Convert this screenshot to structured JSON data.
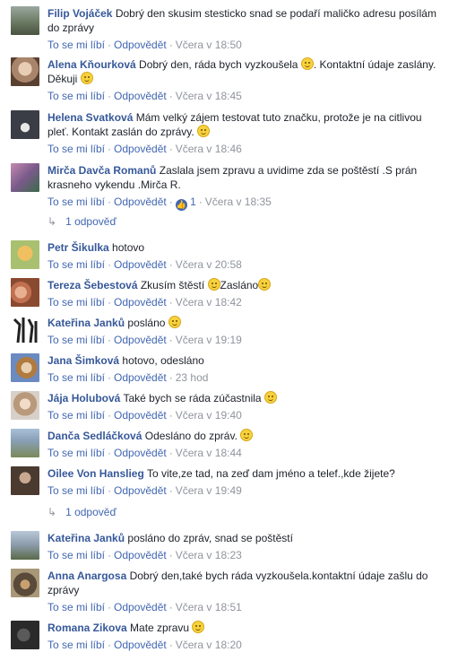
{
  "labels": {
    "like": "To se mi líbí",
    "reply": "Odpovědět",
    "sep": "·"
  },
  "comments": [
    {
      "name": "Filip Vojáček",
      "text": "Dobrý den skusim stesticko snad se podaří maličko adresu posílám do zprávy",
      "time": "Včera v 18:50",
      "avatar_color": "#6b7a62"
    },
    {
      "name": "Alena Kňourková",
      "text": "Dobrý den, ráda bych vyzkoušela",
      "text2": ". Kontaktní údaje zaslány. Děkuji",
      "time": "Včera v 18:45",
      "avatar_color": "#a8846a"
    },
    {
      "name": "Helena Svatková",
      "text": "Mám velký zájem testovat tuto značku, protože je na citlivou pleť. Kontakt zaslán do zprávy.",
      "time": "Včera v 18:46",
      "avatar_color": "#3a3d45"
    },
    {
      "name": "Mirča Davča Romanů",
      "text": "Zaslala jsem zpravu a uvidime zda se poštěstí .S prán krasneho vykendu .Mirča R.",
      "time": "Včera v 18:35",
      "like_count": "1",
      "avatar_color": "#7a5a8a"
    },
    {
      "name": "Petr Šikulka",
      "text": "hotovo",
      "time": "Včera v 20:58",
      "avatar_color": "#d6a84a"
    },
    {
      "name": "Tereza Šebestová",
      "text": "Zkusím štěstí",
      "text2": "Zasláno",
      "time": "Včera v 18:42",
      "avatar_color": "#c07050"
    },
    {
      "name": "Kateřina Janků",
      "text": "posláno",
      "time": "Včera v 19:19",
      "avatar_color": "#222222"
    },
    {
      "name": "Jana Šimková",
      "text": "hotovo, odesláno",
      "time": "23 hod",
      "avatar_color": "#b07a40"
    },
    {
      "name": "Jája Holubová",
      "text": "Také bych se ráda zúčastnila",
      "time": "Včera v 19:40",
      "avatar_color": "#b89a7a"
    },
    {
      "name": "Danča Sedláčková",
      "text": "Odesláno do zpráv.",
      "time": "Včera v 18:44",
      "avatar_color": "#8aa0b8"
    },
    {
      "name": "Oilee Von Hanslieg",
      "text": "To vite,ze tad, na zeď dam jméno a telef.,kde žijete?",
      "time": "Včera v 19:49",
      "avatar_color": "#4a3a30"
    },
    {
      "name": "Kateřina Janků",
      "text": "posláno do zpráv, snad se poštěstí",
      "time": "Včera v 18:23",
      "avatar_color": "#8a9aa8"
    },
    {
      "name": "Anna Anargosa",
      "text": "Dobrý den,také bych ráda vyzkoušela.kontaktní údaje zašlu do zprávy",
      "time": "Včera v 18:51",
      "avatar_color": "#5a4a3a"
    },
    {
      "name": "Romana Zikova",
      "text": "Mate zpravu",
      "time": "Včera v 18:20",
      "avatar_color": "#2a2a2a"
    }
  ],
  "reply_links": [
    {
      "label": "1 odpověď"
    },
    {
      "label": "1 odpověď"
    }
  ]
}
